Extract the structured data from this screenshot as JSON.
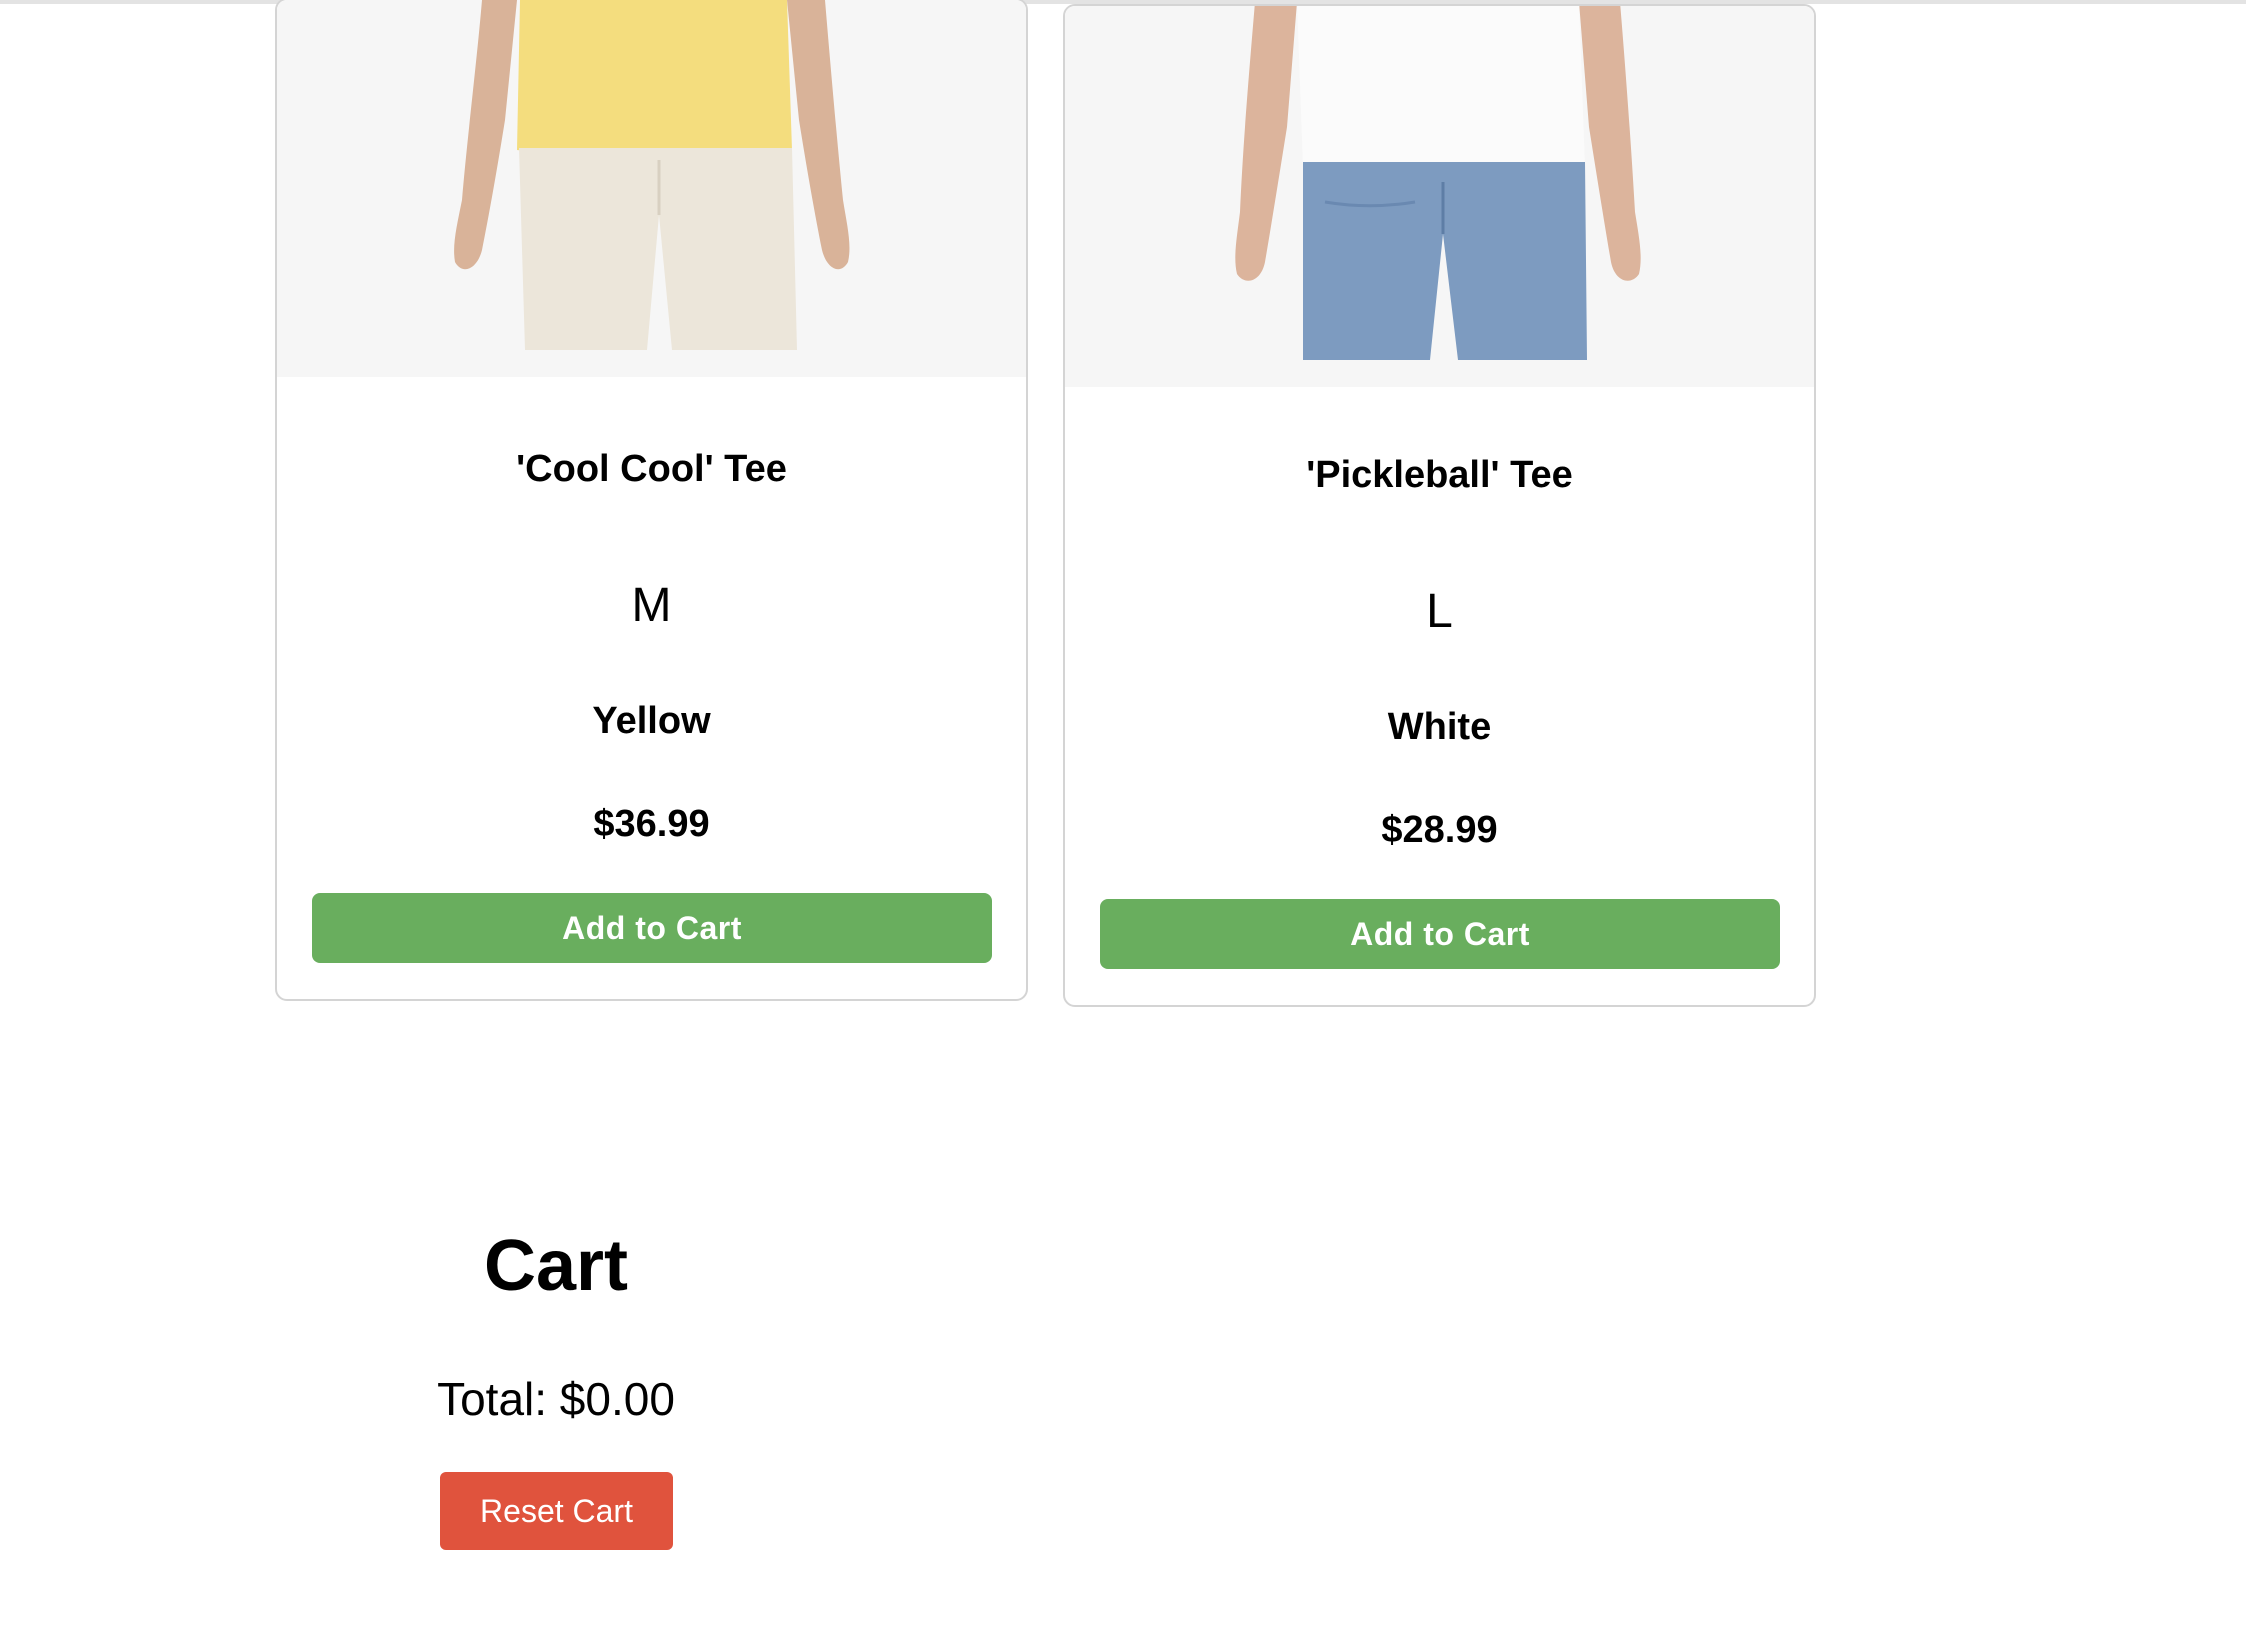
{
  "products": [
    {
      "name": "'Cool Cool' Tee",
      "size": "M",
      "color": "Yellow",
      "price": "$36.99",
      "button_label": "Add to Cart",
      "shirt_color": "#f4dd7e",
      "bottoms_color": "#ece6da"
    },
    {
      "name": "'Pickleball' Tee",
      "size": "L",
      "color": "White",
      "price": "$28.99",
      "button_label": "Add to Cart",
      "shirt_color": "#fbfbfb",
      "bottoms_color": "#7d9bc0"
    }
  ],
  "cart": {
    "title": "Cart",
    "total": "Total: $0.00",
    "reset_label": "Reset Cart"
  },
  "colors": {
    "add_button": "#69ae5e",
    "reset_button": "#e0533d",
    "card_border": "#d4d4d4"
  }
}
